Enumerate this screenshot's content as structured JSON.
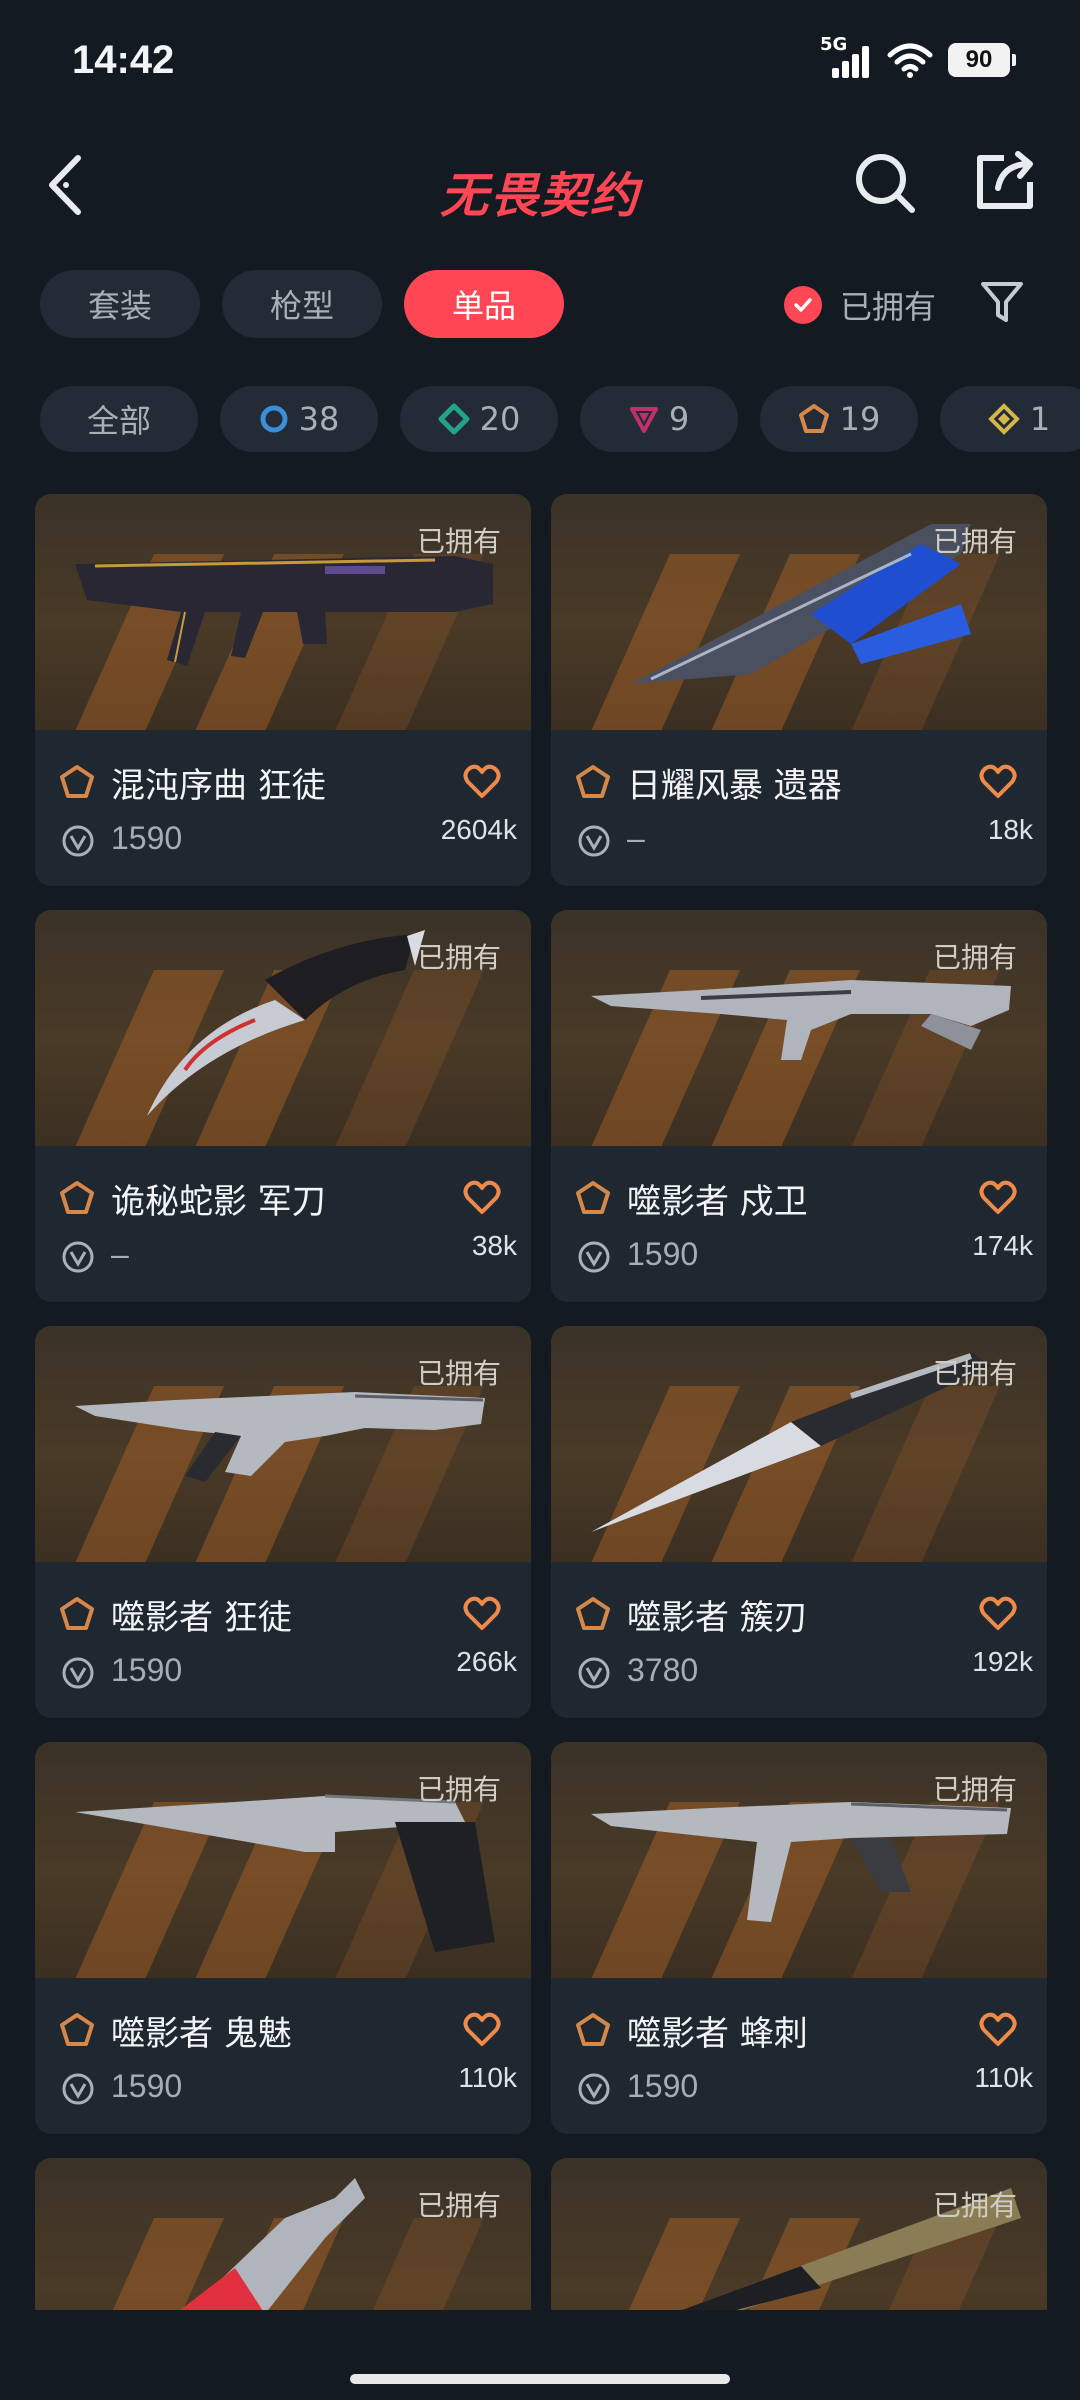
{
  "status": {
    "time": "14:42",
    "network": "5G",
    "battery": "90"
  },
  "header": {
    "title": "无畏契约"
  },
  "tabs": [
    {
      "label": "套装",
      "active": false
    },
    {
      "label": "枪型",
      "active": false
    },
    {
      "label": "单品",
      "active": true
    }
  ],
  "owned_filter": {
    "label": "已拥有",
    "checked": true
  },
  "chips": [
    {
      "label": "全部",
      "icon": ""
    },
    {
      "label": "38",
      "icon": "circle-rarity-icon",
      "color": "#3b8fd9"
    },
    {
      "label": "20",
      "icon": "diamond-rarity-icon",
      "color": "#24a38a"
    },
    {
      "label": "9",
      "icon": "triangle-rarity-icon",
      "color": "#c0306a"
    },
    {
      "label": "19",
      "icon": "pentagon-rarity-icon",
      "color": "#d6884b"
    },
    {
      "label": "1",
      "icon": "rhombus-rarity-icon",
      "color": "#d4b74a"
    }
  ],
  "items": [
    {
      "name": "混沌序曲 狂徒",
      "price": "1590",
      "likes": "2604k",
      "owned": "已拥有"
    },
    {
      "name": "日耀风暴 遗器",
      "price": "–",
      "likes": "18k",
      "owned": "已拥有"
    },
    {
      "name": "诡秘蛇影 军刀",
      "price": "–",
      "likes": "38k",
      "owned": "已拥有"
    },
    {
      "name": "噬影者 戍卫",
      "price": "1590",
      "likes": "174k",
      "owned": "已拥有"
    },
    {
      "name": "噬影者 狂徒",
      "price": "1590",
      "likes": "266k",
      "owned": "已拥有"
    },
    {
      "name": "噬影者 簇刃",
      "price": "3780",
      "likes": "192k",
      "owned": "已拥有"
    },
    {
      "name": "噬影者 鬼魅",
      "price": "1590",
      "likes": "110k",
      "owned": "已拥有"
    },
    {
      "name": "噬影者 蜂刺",
      "price": "1590",
      "likes": "110k",
      "owned": "已拥有"
    },
    {
      "owned": "已拥有"
    },
    {
      "owned": "已拥有"
    }
  ],
  "colors": {
    "accent": "#ff4655",
    "background": "#131a22",
    "card": "#1f2731",
    "heart": "#f08a4b"
  }
}
